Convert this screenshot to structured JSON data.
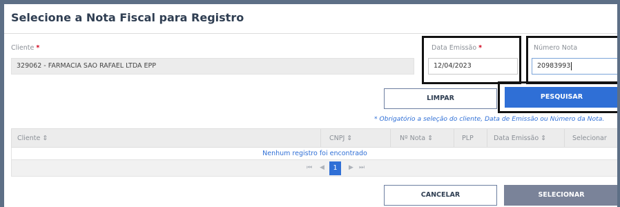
{
  "dialog": {
    "title": "Selecione a Nota Fiscal para Registro"
  },
  "form": {
    "cliente_label": "Cliente",
    "cliente_value": "329062 - FARMACIA SAO RAFAEL LTDA EPP",
    "data_label": "Data Emissão",
    "data_value": "12/04/2023",
    "numero_label": "Número Nota",
    "numero_value": "20983993",
    "required_mark": "*"
  },
  "buttons": {
    "limpar": "LIMPAR",
    "pesquisar": "PESQUISAR",
    "cancelar": "CANCELAR",
    "selecionar": "SELECIONAR"
  },
  "note": "* Obrigatório a seleção do cliente, Data de Emissão ou Número da Nota.",
  "table": {
    "columns": [
      "Cliente ⇕",
      "CNPJ ⇕",
      "Nº Nota ⇕",
      "PLP",
      "Data Emissão ⇕",
      "Selecionar"
    ],
    "empty_message": "Nenhum registro foi encontrado"
  },
  "pager": {
    "first": "⏮",
    "prev": "◀",
    "current": "1",
    "next": "▶",
    "last": "⏭"
  },
  "colors": {
    "accent": "#2f6fd6",
    "disabled_button": "#7a8399"
  }
}
